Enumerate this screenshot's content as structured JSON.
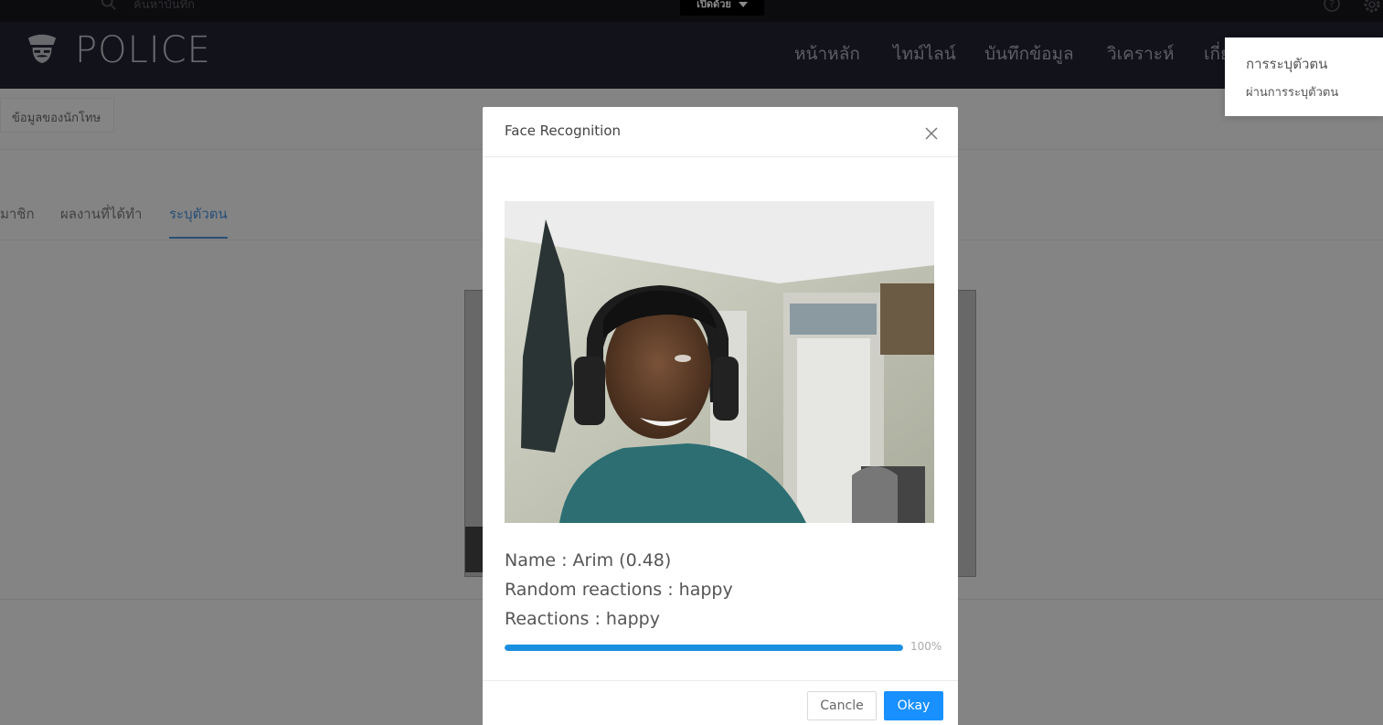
{
  "topbar": {
    "search_placeholder": "ค้นหาบันทึก",
    "language_button": "เปิดด้วย",
    "help_icon": "question-circle-icon",
    "settings_icon": "gear-icon"
  },
  "header": {
    "logo_icon": "police-officer-icon",
    "brand": "POLICE",
    "nav": [
      "หน้าหลัก",
      "ไทม์ไลน์",
      "บันทึกข้อมูล",
      "วิเคราะห์",
      "เกี่ย"
    ]
  },
  "dropdown": {
    "items": [
      "การระบุตัวตน",
      "ผ่านการระบุตัวตน"
    ]
  },
  "page": {
    "breadcrumb": "ข้อมูลของนักโทษ",
    "tabs": [
      "มาชิก",
      "ผลงานที่ได้ทำ",
      "ระบุตัวตน"
    ],
    "active_tab": "ระบุตัวตน"
  },
  "modal": {
    "title": "Face Recognition",
    "name_line": "Name : Arim (0.48)",
    "random_reactions_line": "Random reactions : happy",
    "reactions_line": "Reactions : happy",
    "progress_percent": 100,
    "progress_label": "100%",
    "cancel_label": "Cancle",
    "ok_label": "Okay"
  },
  "colors": {
    "header_bg": "#212130",
    "accent": "#1890ff",
    "progress": "#1b8fdf",
    "active_tab": "#4a90d9"
  }
}
